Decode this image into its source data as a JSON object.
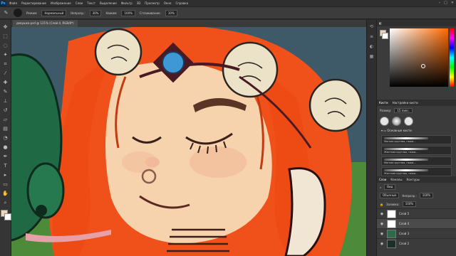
{
  "app": {
    "logo": "Ps",
    "window_controls": [
      "–",
      "□",
      "✕"
    ]
  },
  "menu": [
    "Файл",
    "Редактирование",
    "Изображение",
    "Слои",
    "Текст",
    "Выделение",
    "Фильтр",
    "3D",
    "Просмотр",
    "Окно",
    "Справка"
  ],
  "options": {
    "mode_label": "Режим:",
    "mode_value": "Нормальный",
    "opacity_label": "Непрозр.:",
    "opacity_value": "30%",
    "flow_label": "Нажим:",
    "flow_value": "100%",
    "smoothing_label": "Сглаживание:",
    "smoothing_value": "10%"
  },
  "document": {
    "tab_label": "девушка.psd @ 121% (Слой 4, RGB/8*)"
  },
  "colors": {
    "foreground": "#ead7b8",
    "background": "#ffffff",
    "accent_hue": "#ff6a00"
  },
  "brushes": {
    "tabs": [
      "Кисти",
      "Настройки кисти"
    ],
    "size_label": "Размер:",
    "size_value": "15 пикс.",
    "folder": "Основные кисти",
    "items": [
      "Мягкая круглая, нажи...",
      "Жесткая круглая, нажи...",
      "Мягкая круглая, нажи...",
      "Жесткая круглая, нажи...",
      "Мягкая круглая, нажи...",
      "Жесткая круглая, нажи..."
    ]
  },
  "layers": {
    "tabs": [
      "Слои",
      "Каналы",
      "Контуры"
    ],
    "kind_label": "Вид",
    "blend_value": "Обычные",
    "opacity_label": "Непрозр.:",
    "opacity_value": "100%",
    "fill_label": "Заливка:",
    "fill_value": "100%",
    "items": [
      "Слой 5",
      "Слой 4",
      "Слой 3",
      "Слой 2"
    ]
  }
}
